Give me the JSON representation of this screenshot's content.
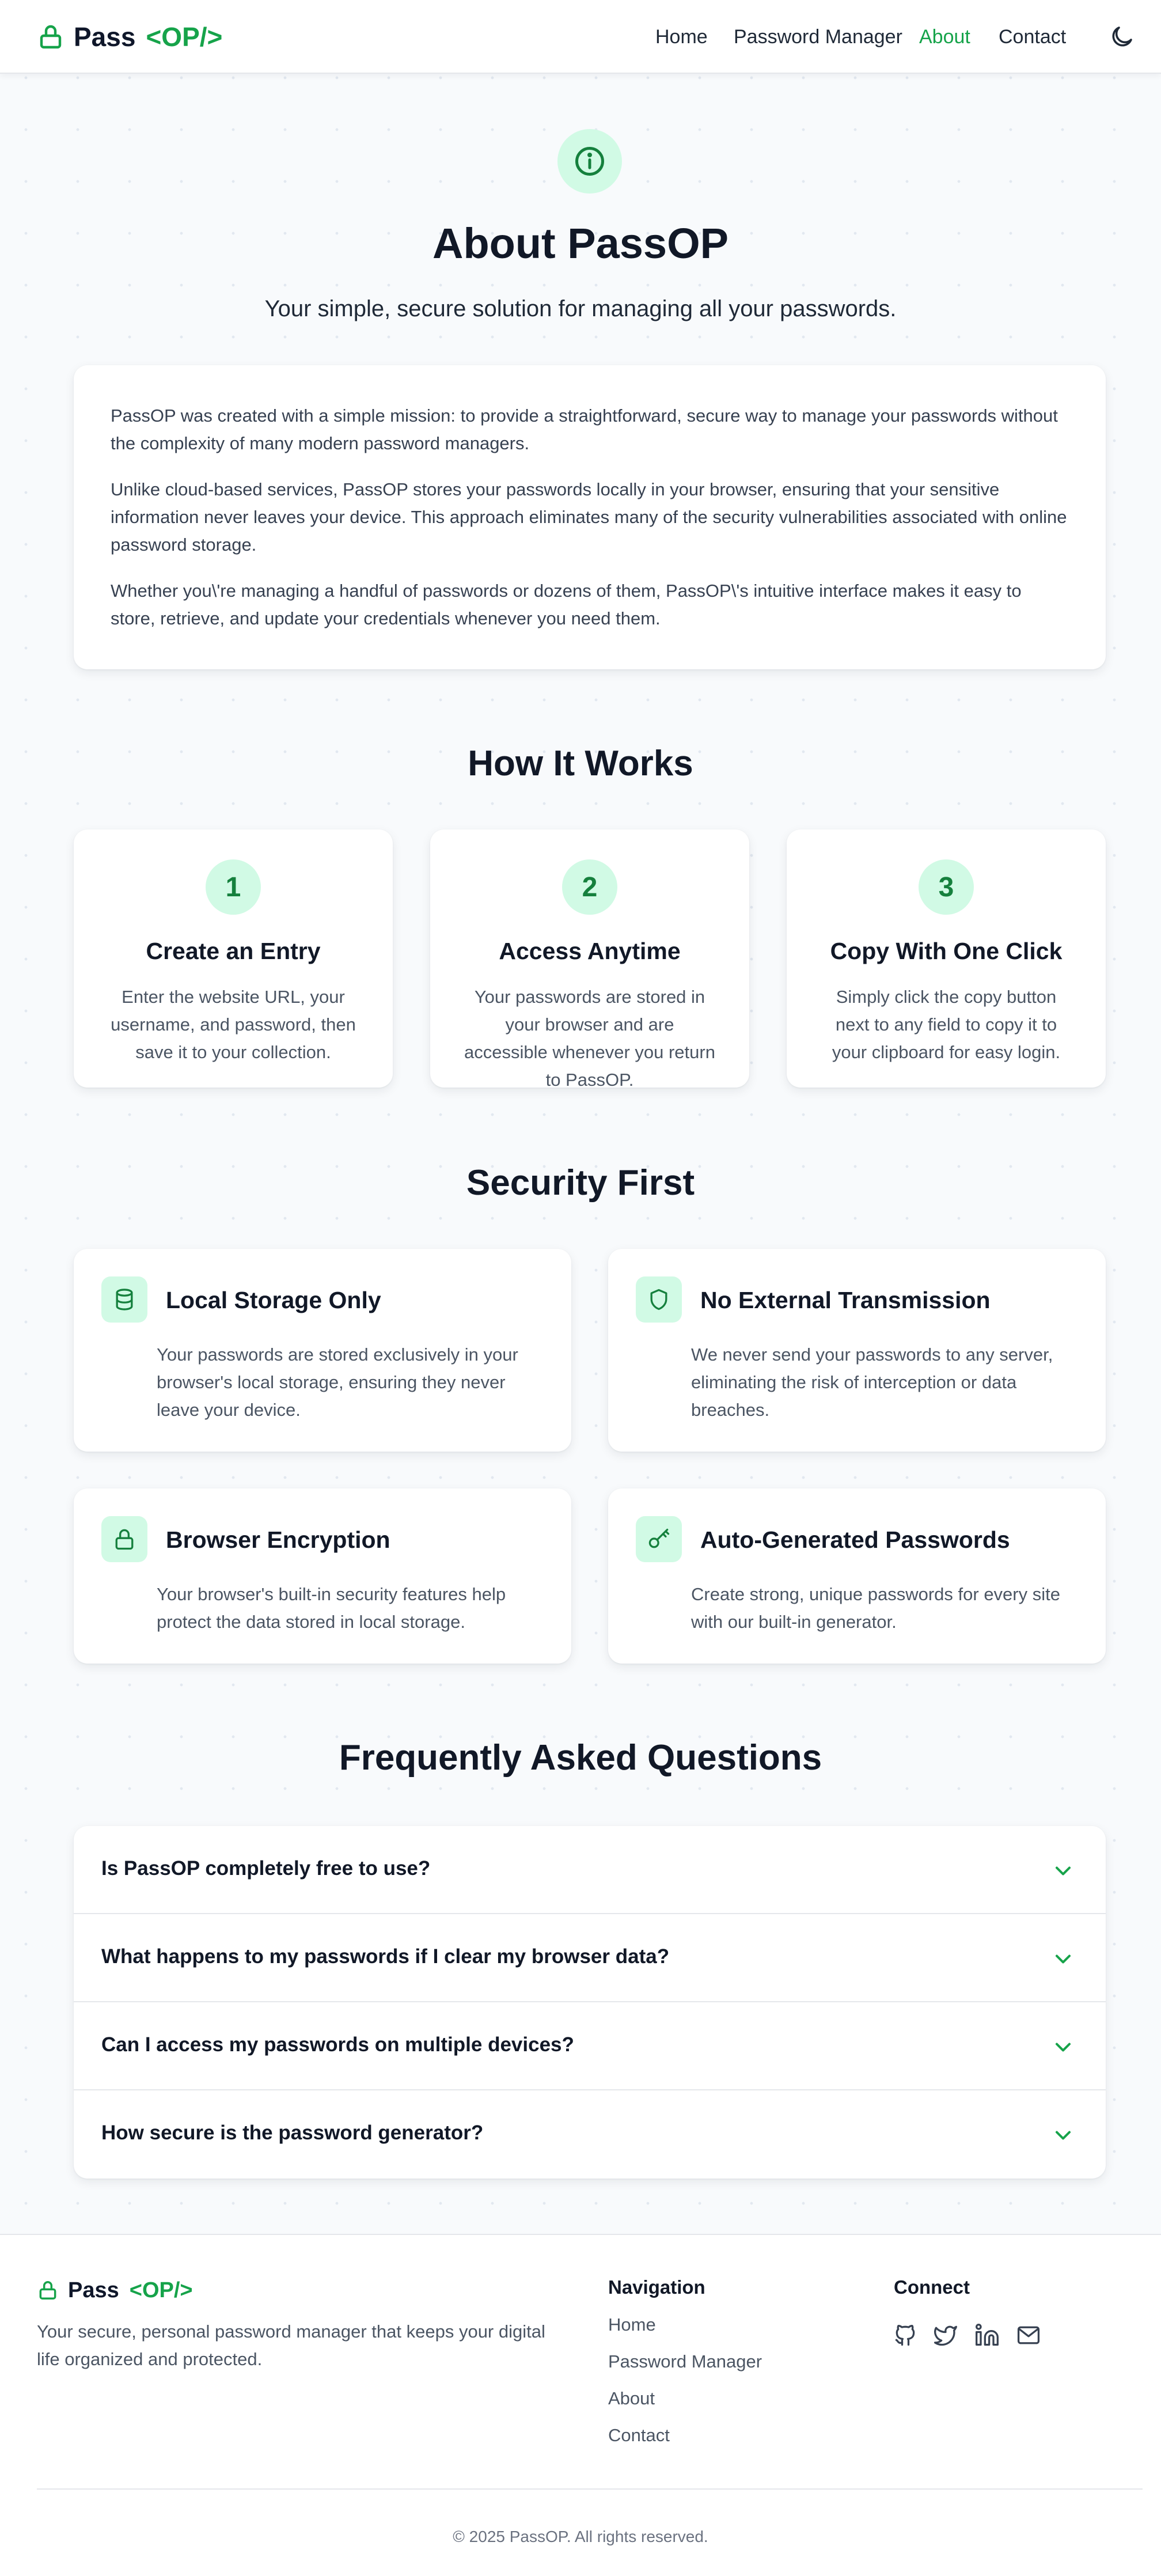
{
  "header": {
    "logo_text": "Pass",
    "logo_accent": "<OP/>",
    "nav": [
      {
        "label": "Home"
      },
      {
        "label": "Password Manager"
      },
      {
        "label": "About",
        "active": true
      },
      {
        "label": "Contact"
      }
    ],
    "theme_icon": "moon-icon"
  },
  "hero": {
    "icon": "info-icon",
    "title": "About PassOP",
    "subtitle": "Your simple, secure solution for managing all your passwords."
  },
  "intro": {
    "paragraphs": [
      "PassOP was created with a simple mission: to provide a straightforward, secure way to manage your passwords without the complexity of many modern password managers.",
      "Unlike cloud-based services, PassOP stores your passwords locally in your browser, ensuring that your sensitive information never leaves your device. This approach eliminates many of the security vulnerabilities associated with online password storage.",
      "Whether you\\'re managing a handful of passwords or dozens of them, PassOP\\'s intuitive interface makes it easy to store, retrieve, and update your credentials whenever you need them."
    ]
  },
  "how": {
    "title": "How It Works",
    "steps": [
      {
        "number": "1",
        "title": "Create an Entry",
        "desc": "Enter the website URL, your username, and password, then save it to your collection."
      },
      {
        "number": "2",
        "title": "Access Anytime",
        "desc": "Your passwords are stored in your browser and are accessible whenever you return to PassOP."
      },
      {
        "number": "3",
        "title": "Copy With One Click",
        "desc": "Simply click the copy button next to any field to copy it to your clipboard for easy login."
      }
    ]
  },
  "security": {
    "title": "Security First",
    "features": [
      {
        "icon": "database-icon",
        "title": "Local Storage Only",
        "desc": "Your passwords are stored exclusively in your browser's local storage, ensuring they never leave your device."
      },
      {
        "icon": "shield-icon",
        "title": "No External Transmission",
        "desc": "We never send your passwords to any server, eliminating the risk of interception or data breaches."
      },
      {
        "icon": "lock-icon",
        "title": "Browser Encryption",
        "desc": "Your browser's built-in security features help protect the data stored in local storage."
      },
      {
        "icon": "key-icon",
        "title": "Auto-Generated Passwords",
        "desc": "Create strong, unique passwords for every site with our built-in generator."
      }
    ]
  },
  "faq": {
    "title": "Frequently Asked Questions",
    "items": [
      {
        "question": "Is PassOP completely free to use?"
      },
      {
        "question": "What happens to my passwords if I clear my browser data?"
      },
      {
        "question": "Can I access my passwords on multiple devices?"
      },
      {
        "question": "How secure is the password generator?"
      }
    ]
  },
  "footer": {
    "logo_text": "Pass",
    "logo_accent": "<OP/>",
    "tagline": "Your secure, personal password manager that keeps your digital life organized and protected.",
    "nav_title": "Navigation",
    "nav_links": [
      "Home",
      "Password Manager",
      "About",
      "Contact"
    ],
    "connect_title": "Connect",
    "social_icons": [
      "github-icon",
      "twitter-icon",
      "linkedin-icon",
      "mail-icon"
    ],
    "copyright": "© 2025 PassOP. All rights reserved."
  },
  "colors": {
    "accent": "#16a34a",
    "accent_light": "#d1fae5",
    "text_dark": "#111827",
    "text_muted": "#4b5563",
    "background": "#f8fafc"
  }
}
